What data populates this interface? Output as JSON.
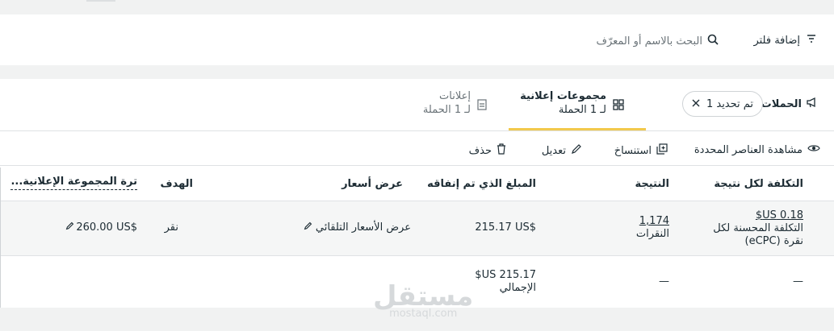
{
  "filter_bar": {
    "add_filter": "إضافة فلتر",
    "search_placeholder": "البحث بالاسم أو المعرّف"
  },
  "tabs": {
    "campaigns": {
      "label": "الحملات"
    },
    "selection_chip": {
      "label": "تم تحديد 1"
    },
    "ad_sets": {
      "title": "مجموعات إعلانية",
      "subtitle": "لـ 1 الحملة"
    },
    "ads": {
      "title": "إعلانات",
      "subtitle": "لـ 1 الحملة"
    }
  },
  "toolbar": {
    "view_selected": "مشاهدة العناصر المحددة",
    "duplicate": "استنساخ",
    "edit": "تعديل",
    "delete": "حذف"
  },
  "table": {
    "columns": {
      "cost_per_result": "التكلفة لكل نتيجة",
      "result": "النتيجة",
      "amount_spent": "المبلغ الذي تم إنفاقه",
      "bid": "عرض أسعار",
      "goal": "الهدف",
      "budget": "...ترة المجموعة الإعلانية"
    },
    "row": {
      "cost_value": "0.18 US$",
      "cost_label": "التكلفة المحسنة لكل نقرة (eCPC)",
      "result_value": "1,174",
      "result_label": "النقرات",
      "amount": "215.17 US$",
      "bid": "عرض الأسعار التلقائي",
      "goal": "نقر",
      "budget": "260.00 US$"
    },
    "totals": {
      "cost": "—",
      "result": "—",
      "amount": "215.17 US$",
      "amount_label": "الإجمالي"
    }
  },
  "watermark": {
    "main": "مستقل",
    "sub": "mostaql.com"
  },
  "colors": {
    "accent": "#f2c94c",
    "text": "#1c2b33",
    "muted": "#6a7378",
    "bg": "#f1f2f2"
  }
}
